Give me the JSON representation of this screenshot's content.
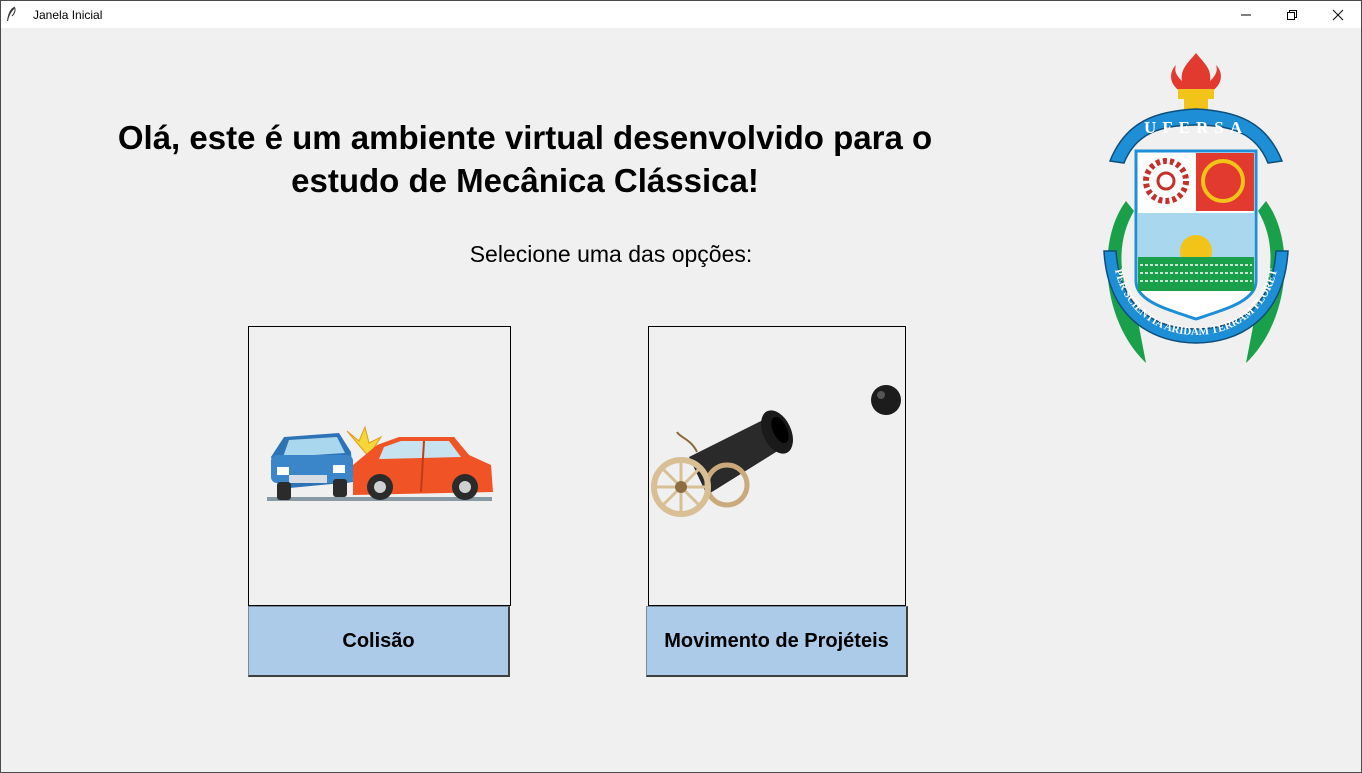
{
  "window": {
    "title": "Janela Inicial",
    "controls": [
      "minimize-icon",
      "restore-icon",
      "close-icon"
    ]
  },
  "main": {
    "heading": "Olá, este é um ambiente virtual desenvolvido para o estudo de Mecânica Clássica!",
    "subtitle": "Selecione uma das opções:",
    "options": [
      {
        "label": "Colisão",
        "image": "car-collision-illustration"
      },
      {
        "label": "Movimento de Projéteis",
        "image": "cannon-illustration"
      }
    ]
  },
  "logo": {
    "top_text": "UFERSA",
    "motto": "PER SCIENTIA ARIDAM TERRAM FLORET"
  },
  "colors": {
    "button_bg": "#abcbe8",
    "window_bg": "#f0f0f0",
    "logo_blue": "#1e8fd6",
    "logo_green": "#1aa04a",
    "logo_red": "#e23a2e"
  }
}
